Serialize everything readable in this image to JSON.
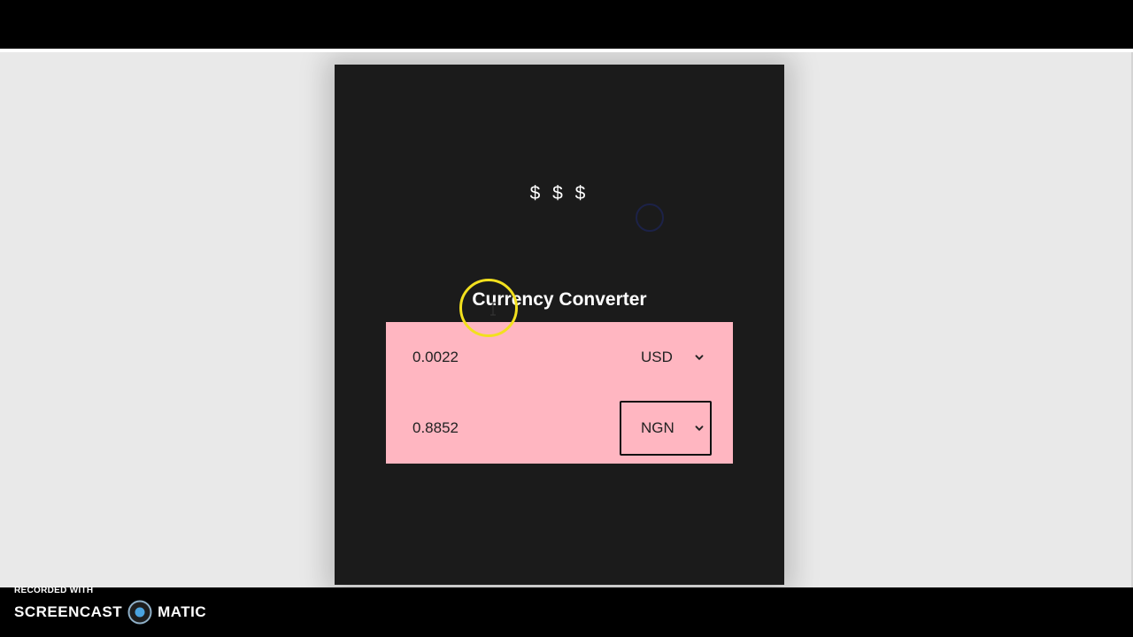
{
  "app": {
    "logo_text": "$ $ $",
    "title": "Currency Converter"
  },
  "converter": {
    "from": {
      "amount": "0.0022",
      "currency": "USD",
      "focused": false
    },
    "to": {
      "amount": "0.8852",
      "currency": "NGN",
      "focused": true
    }
  },
  "colors": {
    "card_background": "#1b1b1b",
    "panel_background": "#ffb6c1",
    "page_background": "#e9e9e9",
    "cursor_highlight": "#f2e01e"
  },
  "watermark": {
    "recorded_with": "RECORDED WITH",
    "brand_left": "SCREENCAST",
    "brand_right": "MATIC"
  },
  "icons": {
    "select_arrow": "chevron-down-icon",
    "cursor": "text-cursor-icon",
    "brand_mark": "record-icon"
  }
}
